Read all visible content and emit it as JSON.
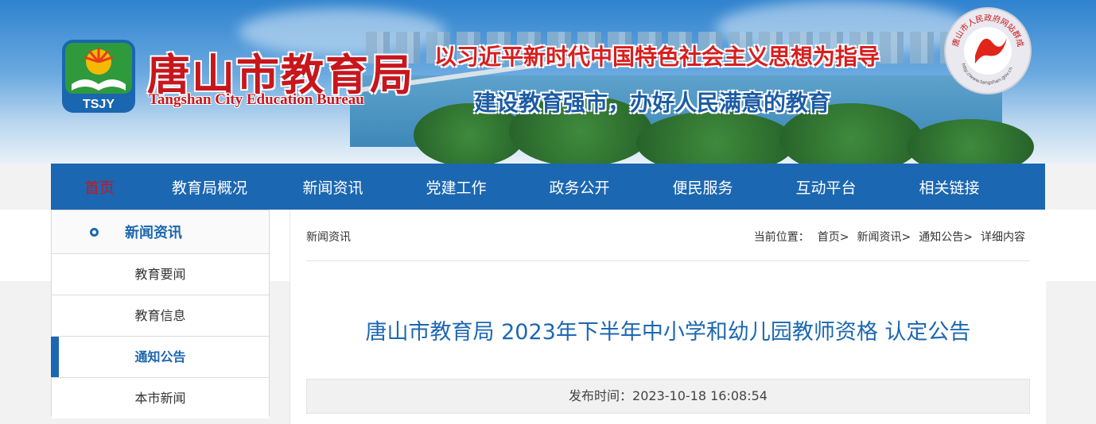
{
  "header": {
    "title_cn": "唐山市教育局",
    "title_en": "Tangshan City Education Bureau",
    "logo_text": "TSJY",
    "slogan_1": "以习近平新时代中国特色社会主义思想为指导",
    "slogan_2": "建设教育强市，办好人民满意的教育",
    "seal_text": "唐山市人民政府网站群成员",
    "seal_url": "http://www.tangshan.gov.cn"
  },
  "nav": {
    "items": [
      {
        "label": "首页"
      },
      {
        "label": "教育局概况"
      },
      {
        "label": "新闻资讯"
      },
      {
        "label": "党建工作"
      },
      {
        "label": "政务公开"
      },
      {
        "label": "便民服务"
      },
      {
        "label": "互动平台"
      },
      {
        "label": "相关链接"
      }
    ]
  },
  "sidebar": {
    "title": "新闻资讯",
    "items": [
      {
        "label": "教育要闻"
      },
      {
        "label": "教育信息"
      },
      {
        "label": "通知公告"
      },
      {
        "label": "本市新闻"
      }
    ]
  },
  "breadcrumb": {
    "section": "新闻资讯",
    "prefix": "当前位置：",
    "links": [
      "首页>",
      "新闻资讯>",
      "通知公告>",
      "详细内容"
    ]
  },
  "article": {
    "title": "唐山市教育局 2023年下半年中小学和幼儿园教师资格 认定公告",
    "publish_label": "发布时间：",
    "publish_time": "2023-10-18 16:08:54"
  },
  "colors": {
    "nav_blue": "#1c67b1",
    "brand_red": "#c8161d",
    "slogan_blue": "#1d5ba4"
  }
}
